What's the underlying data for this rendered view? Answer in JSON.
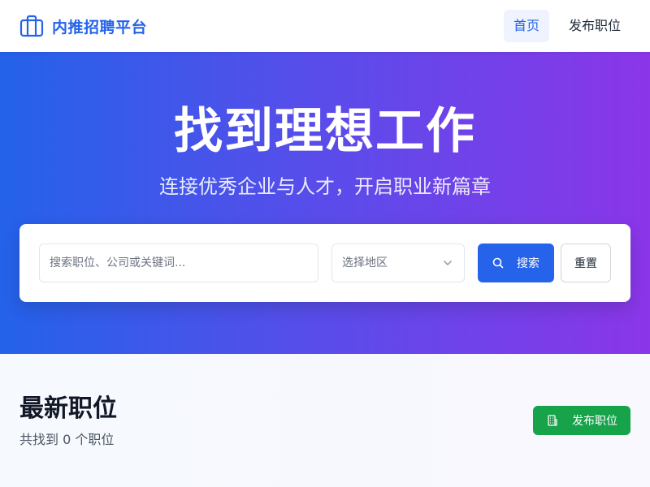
{
  "navbar": {
    "brand_name": "内推招聘平台",
    "brand_icon": "briefcase-icon",
    "links": [
      {
        "label": "首页",
        "active": true
      },
      {
        "label": "发布职位",
        "active": false
      }
    ]
  },
  "hero": {
    "title": "找到理想工作",
    "subtitle": "连接优秀企业与人才，开启职业新篇章"
  },
  "search": {
    "placeholder": "搜索职位、公司或关键词...",
    "region_selected": "选择地区",
    "search_label": "搜索",
    "search_icon": "search-icon",
    "reset_label": "重置"
  },
  "jobs": {
    "title": "最新职位",
    "count_text": "共找到 0 个职位",
    "post_label": "发布职位",
    "post_icon": "building-icon"
  },
  "colors": {
    "primary": "#2563eb",
    "gradient_start": "#2462ea",
    "gradient_end": "#8b36e8",
    "success": "#16a34a"
  }
}
